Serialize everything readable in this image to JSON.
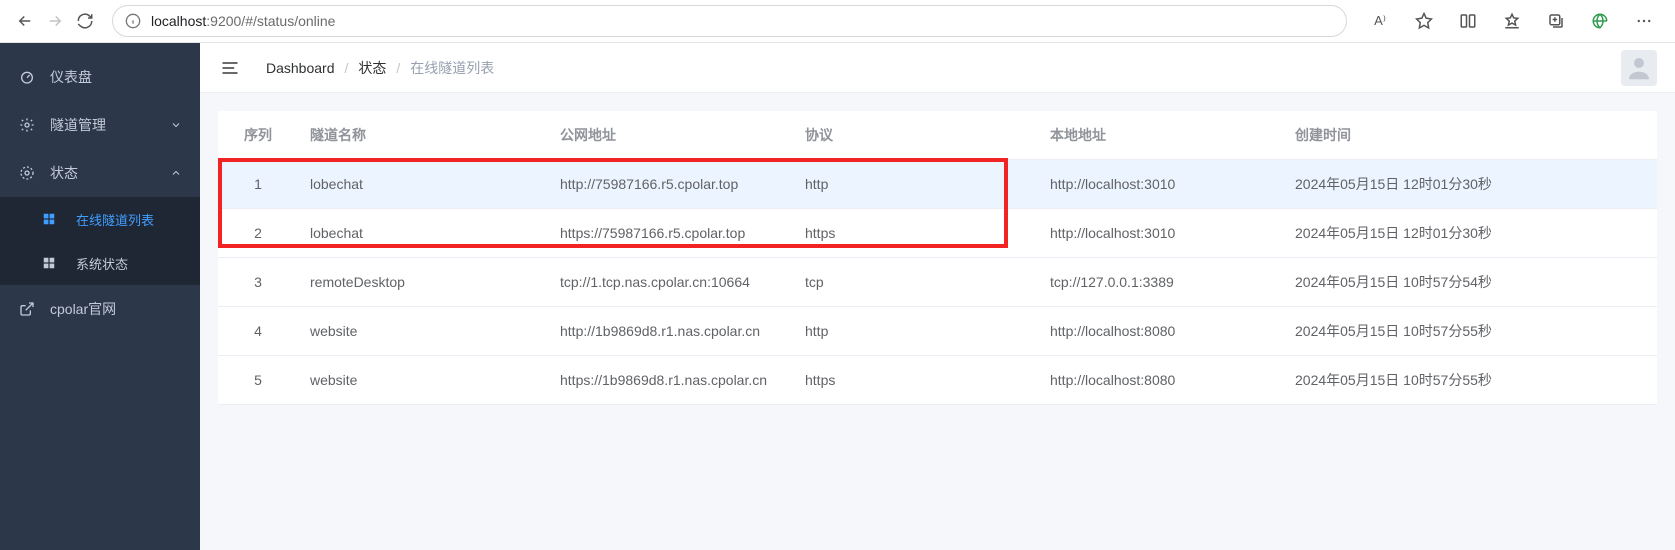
{
  "browser": {
    "url_host": "localhost",
    "url_path": ":9200/#/status/online",
    "read_aloud_label": "A⁾"
  },
  "sidebar": {
    "dashboard": "仪表盘",
    "tunnel_mgmt": "隧道管理",
    "status": "状态",
    "online_list": "在线隧道列表",
    "system_status": "系统状态",
    "cpolar_site": "cpolar官网"
  },
  "breadcrumb": {
    "b0": "Dashboard",
    "b1": "状态",
    "b2": "在线隧道列表"
  },
  "table": {
    "headers": {
      "idx": "序列",
      "name": "隧道名称",
      "url": "公网地址",
      "proto": "协议",
      "local": "本地地址",
      "created": "创建时间"
    },
    "rows": [
      {
        "idx": "1",
        "name": "lobechat",
        "url": "http://75987166.r5.cpolar.top",
        "proto": "http",
        "local": "http://localhost:3010",
        "created": "2024年05月15日 12时01分30秒",
        "hl": true
      },
      {
        "idx": "2",
        "name": "lobechat",
        "url": "https://75987166.r5.cpolar.top",
        "proto": "https",
        "local": "http://localhost:3010",
        "created": "2024年05月15日 12时01分30秒",
        "hl": false
      },
      {
        "idx": "3",
        "name": "remoteDesktop",
        "url": "tcp://1.tcp.nas.cpolar.cn:10664",
        "proto": "tcp",
        "local": "tcp://127.0.0.1:3389",
        "created": "2024年05月15日 10时57分54秒",
        "hl": false
      },
      {
        "idx": "4",
        "name": "website",
        "url": "http://1b9869d8.r1.nas.cpolar.cn",
        "proto": "http",
        "local": "http://localhost:8080",
        "created": "2024年05月15日 10时57分55秒",
        "hl": false
      },
      {
        "idx": "5",
        "name": "website",
        "url": "https://1b9869d8.r1.nas.cpolar.cn",
        "proto": "https",
        "local": "http://localhost:8080",
        "created": "2024年05月15日 10时57分55秒",
        "hl": false
      }
    ]
  }
}
